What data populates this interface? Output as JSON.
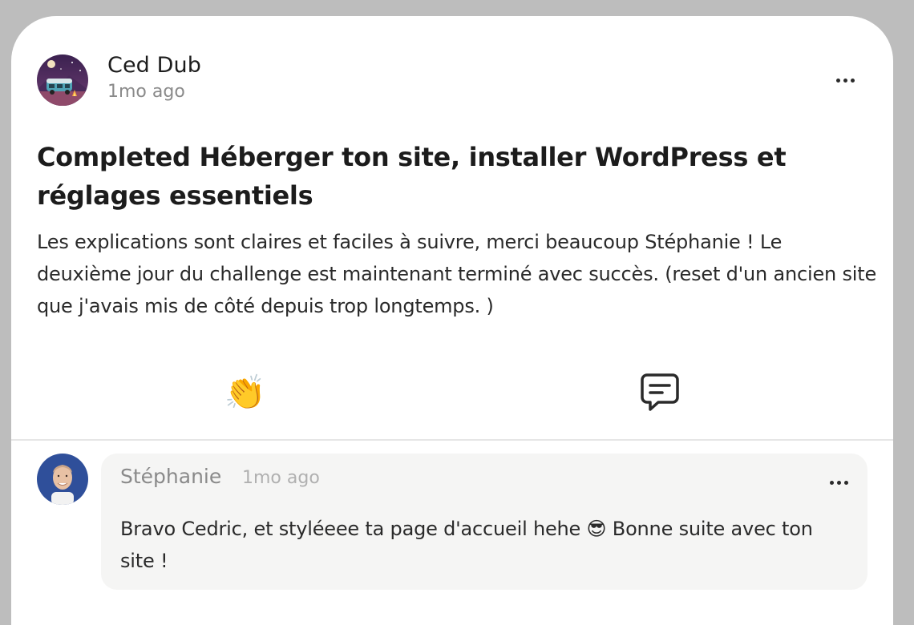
{
  "post": {
    "author_name": "Ced Dub",
    "time": "1mo ago",
    "title": "Completed Héberger ton site, installer WordPress et réglages essentiels",
    "body": "Les explications sont claires et faciles à suivre, merci beaucoup Stéphanie ! Le deuxième jour du challenge est maintenant terminé avec succès. (reset d'un ancien site que j'avais mis de côté depuis trop longtemps. )",
    "clap_icon": "👏",
    "comment_icon": "comment-icon"
  },
  "comment": {
    "author_name": "Stéphanie",
    "time": "1mo ago",
    "text": "Bravo Cedric, et styléeee ta page d'accueil hehe 😎 Bonne suite avec ton site !"
  },
  "colors": {
    "card_background": "#ffffff",
    "page_background": "#bdbdbd",
    "comment_bubble": "#f5f5f4",
    "text_primary": "#1c1c1c",
    "text_muted": "#8a8a8a"
  }
}
